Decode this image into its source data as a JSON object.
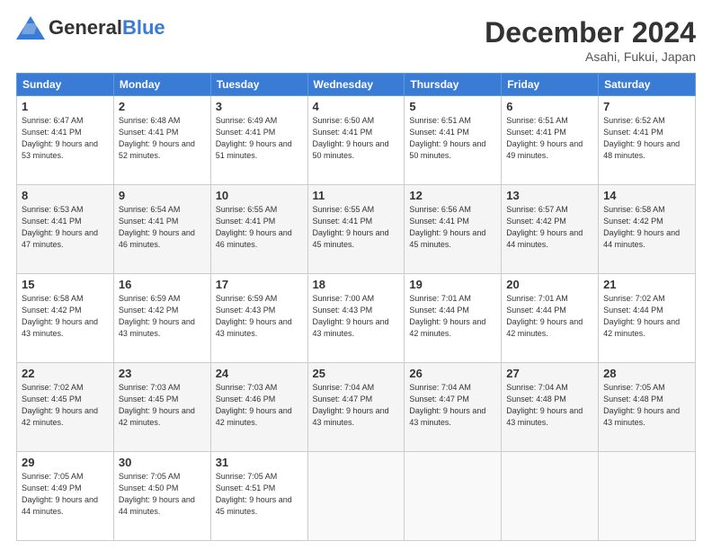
{
  "header": {
    "logo_general": "General",
    "logo_blue": "Blue",
    "month_title": "December 2024",
    "location": "Asahi, Fukui, Japan"
  },
  "days_of_week": [
    "Sunday",
    "Monday",
    "Tuesday",
    "Wednesday",
    "Thursday",
    "Friday",
    "Saturday"
  ],
  "weeks": [
    [
      {
        "day": "1",
        "sunrise": "6:47 AM",
        "sunset": "4:41 PM",
        "daylight": "9 hours and 53 minutes."
      },
      {
        "day": "2",
        "sunrise": "6:48 AM",
        "sunset": "4:41 PM",
        "daylight": "9 hours and 52 minutes."
      },
      {
        "day": "3",
        "sunrise": "6:49 AM",
        "sunset": "4:41 PM",
        "daylight": "9 hours and 51 minutes."
      },
      {
        "day": "4",
        "sunrise": "6:50 AM",
        "sunset": "4:41 PM",
        "daylight": "9 hours and 50 minutes."
      },
      {
        "day": "5",
        "sunrise": "6:51 AM",
        "sunset": "4:41 PM",
        "daylight": "9 hours and 50 minutes."
      },
      {
        "day": "6",
        "sunrise": "6:51 AM",
        "sunset": "4:41 PM",
        "daylight": "9 hours and 49 minutes."
      },
      {
        "day": "7",
        "sunrise": "6:52 AM",
        "sunset": "4:41 PM",
        "daylight": "9 hours and 48 minutes."
      }
    ],
    [
      {
        "day": "8",
        "sunrise": "6:53 AM",
        "sunset": "4:41 PM",
        "daylight": "9 hours and 47 minutes."
      },
      {
        "day": "9",
        "sunrise": "6:54 AM",
        "sunset": "4:41 PM",
        "daylight": "9 hours and 46 minutes."
      },
      {
        "day": "10",
        "sunrise": "6:55 AM",
        "sunset": "4:41 PM",
        "daylight": "9 hours and 46 minutes."
      },
      {
        "day": "11",
        "sunrise": "6:55 AM",
        "sunset": "4:41 PM",
        "daylight": "9 hours and 45 minutes."
      },
      {
        "day": "12",
        "sunrise": "6:56 AM",
        "sunset": "4:41 PM",
        "daylight": "9 hours and 45 minutes."
      },
      {
        "day": "13",
        "sunrise": "6:57 AM",
        "sunset": "4:42 PM",
        "daylight": "9 hours and 44 minutes."
      },
      {
        "day": "14",
        "sunrise": "6:58 AM",
        "sunset": "4:42 PM",
        "daylight": "9 hours and 44 minutes."
      }
    ],
    [
      {
        "day": "15",
        "sunrise": "6:58 AM",
        "sunset": "4:42 PM",
        "daylight": "9 hours and 43 minutes."
      },
      {
        "day": "16",
        "sunrise": "6:59 AM",
        "sunset": "4:42 PM",
        "daylight": "9 hours and 43 minutes."
      },
      {
        "day": "17",
        "sunrise": "6:59 AM",
        "sunset": "4:43 PM",
        "daylight": "9 hours and 43 minutes."
      },
      {
        "day": "18",
        "sunrise": "7:00 AM",
        "sunset": "4:43 PM",
        "daylight": "9 hours and 43 minutes."
      },
      {
        "day": "19",
        "sunrise": "7:01 AM",
        "sunset": "4:44 PM",
        "daylight": "9 hours and 42 minutes."
      },
      {
        "day": "20",
        "sunrise": "7:01 AM",
        "sunset": "4:44 PM",
        "daylight": "9 hours and 42 minutes."
      },
      {
        "day": "21",
        "sunrise": "7:02 AM",
        "sunset": "4:44 PM",
        "daylight": "9 hours and 42 minutes."
      }
    ],
    [
      {
        "day": "22",
        "sunrise": "7:02 AM",
        "sunset": "4:45 PM",
        "daylight": "9 hours and 42 minutes."
      },
      {
        "day": "23",
        "sunrise": "7:03 AM",
        "sunset": "4:45 PM",
        "daylight": "9 hours and 42 minutes."
      },
      {
        "day": "24",
        "sunrise": "7:03 AM",
        "sunset": "4:46 PM",
        "daylight": "9 hours and 42 minutes."
      },
      {
        "day": "25",
        "sunrise": "7:04 AM",
        "sunset": "4:47 PM",
        "daylight": "9 hours and 43 minutes."
      },
      {
        "day": "26",
        "sunrise": "7:04 AM",
        "sunset": "4:47 PM",
        "daylight": "9 hours and 43 minutes."
      },
      {
        "day": "27",
        "sunrise": "7:04 AM",
        "sunset": "4:48 PM",
        "daylight": "9 hours and 43 minutes."
      },
      {
        "day": "28",
        "sunrise": "7:05 AM",
        "sunset": "4:48 PM",
        "daylight": "9 hours and 43 minutes."
      }
    ],
    [
      {
        "day": "29",
        "sunrise": "7:05 AM",
        "sunset": "4:49 PM",
        "daylight": "9 hours and 44 minutes."
      },
      {
        "day": "30",
        "sunrise": "7:05 AM",
        "sunset": "4:50 PM",
        "daylight": "9 hours and 44 minutes."
      },
      {
        "day": "31",
        "sunrise": "7:05 AM",
        "sunset": "4:51 PM",
        "daylight": "9 hours and 45 minutes."
      },
      null,
      null,
      null,
      null
    ]
  ]
}
